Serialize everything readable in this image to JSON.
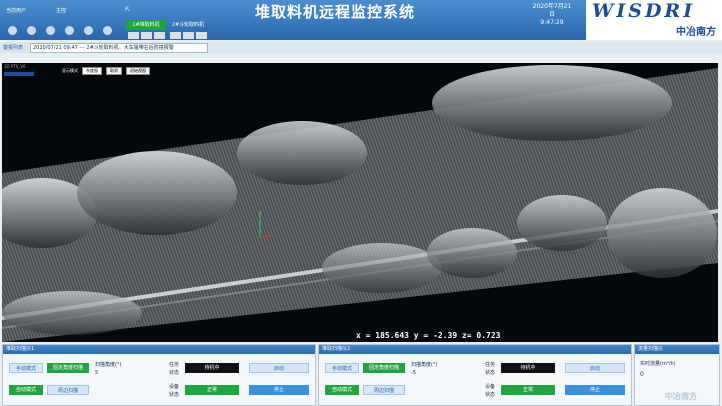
{
  "header": {
    "user": "当前用户",
    "role": "主控",
    "exit": "⇱",
    "title": "堆取料机远程监控系统",
    "date": "2020年7月21日",
    "time": "9:47:29",
    "machine1": "1#堆取料机",
    "machine2": "2#斗轮取料机"
  },
  "logo": {
    "text": "WISDRI",
    "cn": "中冶南方"
  },
  "alarm": {
    "label": "警报列表",
    "message": "2020/07/21 09:47 --- 2#斗轮取料机：大车履带右后防撞报警"
  },
  "viewer": {
    "title": "3D PTS_V6",
    "filter_label": "显示模式",
    "filter_value": "灰度图",
    "btn_cancel": "取消",
    "btn_init": "初始视图",
    "coords": "x = 185.643 y = -2.39 z= 0.723"
  },
  "panel1": {
    "title": "堆取扫描仪1",
    "manual": "手动模式",
    "fixed_scan": "固定角度扫描",
    "angle_label": "扫描角度(°)",
    "angle_value": "5",
    "task_label": "任务",
    "state_label": "状态",
    "task_value": "待机中",
    "start": "启动",
    "auto": "自动模式",
    "cycle_scan": "周边扫描",
    "dev_label": "设备",
    "dev_state_label": "状态",
    "dev_value": "正常",
    "stop": "停止"
  },
  "panel2": {
    "title": "堆取扫描仪2",
    "manual": "手动模式",
    "fixed_scan": "固定角度扫描",
    "angle_label": "扫描角度(°)",
    "angle_value": "-5",
    "task_label": "任务",
    "state_label": "状态",
    "task_value": "待机中",
    "start": "启动",
    "auto": "自动模式",
    "cycle_scan": "周边扫描",
    "dev_label": "设备",
    "dev_state_label": "状态",
    "dev_value": "正常",
    "stop": "停止"
  },
  "panel3": {
    "title": "流量扫描仪",
    "flow_label": "实时流量(m³/h)",
    "flow_value": "0",
    "footer": "中冶南方"
  }
}
